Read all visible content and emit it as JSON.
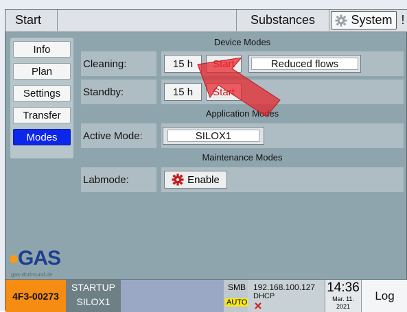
{
  "topbar": {
    "start_label": "Start",
    "substances_label": "Substances",
    "system_label": "System",
    "extra_label": "!"
  },
  "menu": {
    "items": [
      {
        "label": "Info",
        "active": false
      },
      {
        "label": "Plan",
        "active": false
      },
      {
        "label": "Settings",
        "active": false
      },
      {
        "label": "Transfer",
        "active": false
      },
      {
        "label": "Modes",
        "active": true
      }
    ]
  },
  "sections": {
    "device_modes": "Device Modes",
    "application_modes": "Application Modes",
    "maintenance_modes": "Maintenance Modes"
  },
  "cleaning": {
    "label": "Cleaning:",
    "hours": "15 h",
    "start_label": "Start",
    "flow_mode": "Reduced flows"
  },
  "standby": {
    "label": "Standby:",
    "hours": "15 h",
    "start_label": "Start"
  },
  "active_mode": {
    "label": "Active Mode:",
    "value": "SILOX1"
  },
  "labmode": {
    "label": "Labmode:",
    "enable_label": "Enable"
  },
  "logo": {
    "name": "GAS",
    "sub": "gas-dortmund.de"
  },
  "status": {
    "device_id": "4F3-00273",
    "state_line1": "STARTUP",
    "state_line2": "SILOX1",
    "smb": "SMB",
    "auto": "AUTO",
    "ip": "192.168.100.127",
    "dhcp": "DHCP",
    "time": "14:36",
    "date_line1": "Mar. 11.",
    "date_line2": "2021",
    "log_label": "Log"
  },
  "colors": {
    "accent_active": "#0d27ea",
    "start_text": "#d01b1b",
    "device_id_bg": "#f68c12",
    "arrow": "#e8232a"
  },
  "icons": [
    "gear-icon",
    "flower-gear-icon",
    "red-x-icon",
    "arrow-pointer-icon"
  ]
}
